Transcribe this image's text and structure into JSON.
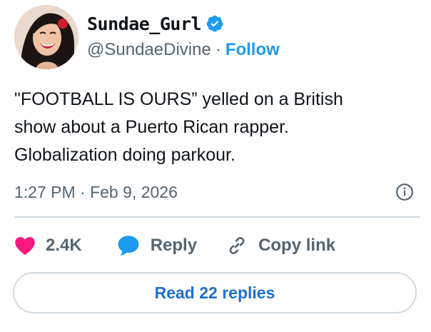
{
  "author": {
    "display_name": "Sundae_Gurl",
    "handle": "@SundaeDivine",
    "separator": "·",
    "follow_label": "Follow"
  },
  "tweet": {
    "lines": [
      "\"FOOTBALL IS OURS” yelled on a British",
      "show about a Puerto Rican rapper.",
      "Globalization doing parkour."
    ],
    "timestamp": "1:27 PM · Feb 9, 2026"
  },
  "actions": {
    "likes": "2.4K",
    "reply_label": "Reply",
    "copy_link_label": "Copy link"
  },
  "read_replies_label": "Read 22 replies",
  "colors": {
    "accent": "#1d9bf0",
    "like": "#f91880",
    "text": "#0f1419",
    "muted": "#536471",
    "border": "#cfd9de"
  },
  "icons": [
    "verified-badge-icon",
    "info-icon",
    "heart-icon",
    "reply-bubble-icon",
    "link-icon"
  ]
}
